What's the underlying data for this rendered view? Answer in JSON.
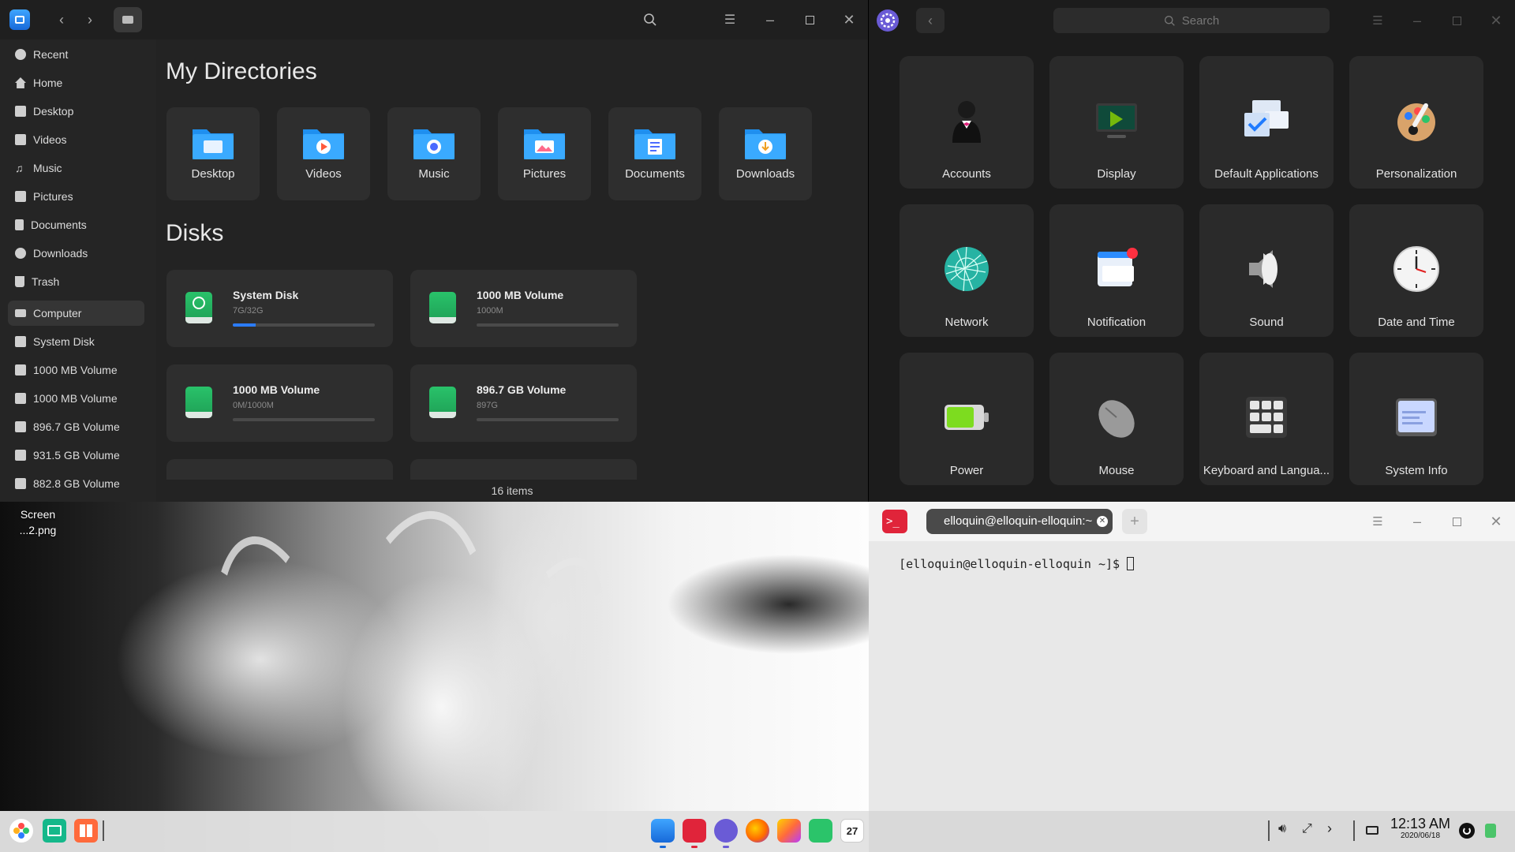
{
  "desktop": {
    "icon_label": "Screen\n...2.png"
  },
  "file_manager": {
    "sidebar": [
      {
        "label": "Recent",
        "icon": "clock-icon"
      },
      {
        "label": "Home",
        "icon": "home-icon"
      },
      {
        "label": "Desktop",
        "icon": "desktop-icon"
      },
      {
        "label": "Videos",
        "icon": "video-icon"
      },
      {
        "label": "Music",
        "icon": "music-icon"
      },
      {
        "label": "Pictures",
        "icon": "picture-icon"
      },
      {
        "label": "Documents",
        "icon": "document-icon"
      },
      {
        "label": "Downloads",
        "icon": "download-icon"
      },
      {
        "label": "Trash",
        "icon": "trash-icon"
      },
      {
        "label": "Computer",
        "icon": "computer-icon",
        "active": true
      },
      {
        "label": "System Disk",
        "icon": "disk-icon"
      },
      {
        "label": "1000 MB Volume",
        "icon": "disk-icon"
      },
      {
        "label": "1000 MB Volume",
        "icon": "disk-icon"
      },
      {
        "label": "896.7 GB Volume",
        "icon": "disk-icon"
      },
      {
        "label": "931.5 GB Volume",
        "icon": "disk-icon"
      },
      {
        "label": "882.8 GB Volume",
        "icon": "disk-icon"
      }
    ],
    "my_directories_title": "My Directories",
    "directories": [
      {
        "label": "Desktop",
        "color": "#2b9df5"
      },
      {
        "label": "Videos",
        "color": "#2b9df5"
      },
      {
        "label": "Music",
        "color": "#2b9df5"
      },
      {
        "label": "Pictures",
        "color": "#2b9df5"
      },
      {
        "label": "Documents",
        "color": "#2b9df5"
      },
      {
        "label": "Downloads",
        "color": "#2b9df5"
      }
    ],
    "disks_title": "Disks",
    "disks": [
      {
        "name": "System Disk",
        "size": "7G/32G",
        "usage": 0.16
      },
      {
        "name": "1000 MB Volume",
        "size": "1000M",
        "usage": 0
      },
      {
        "name": "1000 MB Volume",
        "size": "0M/1000M",
        "usage": 0
      },
      {
        "name": "896.7 GB Volume",
        "size": "897G",
        "usage": 0
      }
    ],
    "status": "16 items"
  },
  "control_center": {
    "search_placeholder": "Search",
    "tiles": [
      {
        "label": "Accounts",
        "icon": "accounts-icon"
      },
      {
        "label": "Display",
        "icon": "display-icon"
      },
      {
        "label": "Default Applications",
        "icon": "default-applications-icon"
      },
      {
        "label": "Personalization",
        "icon": "personalization-icon"
      },
      {
        "label": "Network",
        "icon": "network-icon"
      },
      {
        "label": "Notification",
        "icon": "notification-icon"
      },
      {
        "label": "Sound",
        "icon": "sound-icon"
      },
      {
        "label": "Date and Time",
        "icon": "clock-icon"
      },
      {
        "label": "Power",
        "icon": "battery-icon"
      },
      {
        "label": "Mouse",
        "icon": "mouse-icon"
      },
      {
        "label": "Keyboard and Langua...",
        "icon": "keyboard-icon"
      },
      {
        "label": "System Info",
        "icon": "system-info-icon"
      }
    ]
  },
  "terminal": {
    "tab_title": "elloquin@elloquin-elloquin:~",
    "prompt": "[elloquin@elloquin-elloquin ~]$ "
  },
  "taskbar": {
    "time": "12:13 AM",
    "date": "2020/06/18"
  }
}
